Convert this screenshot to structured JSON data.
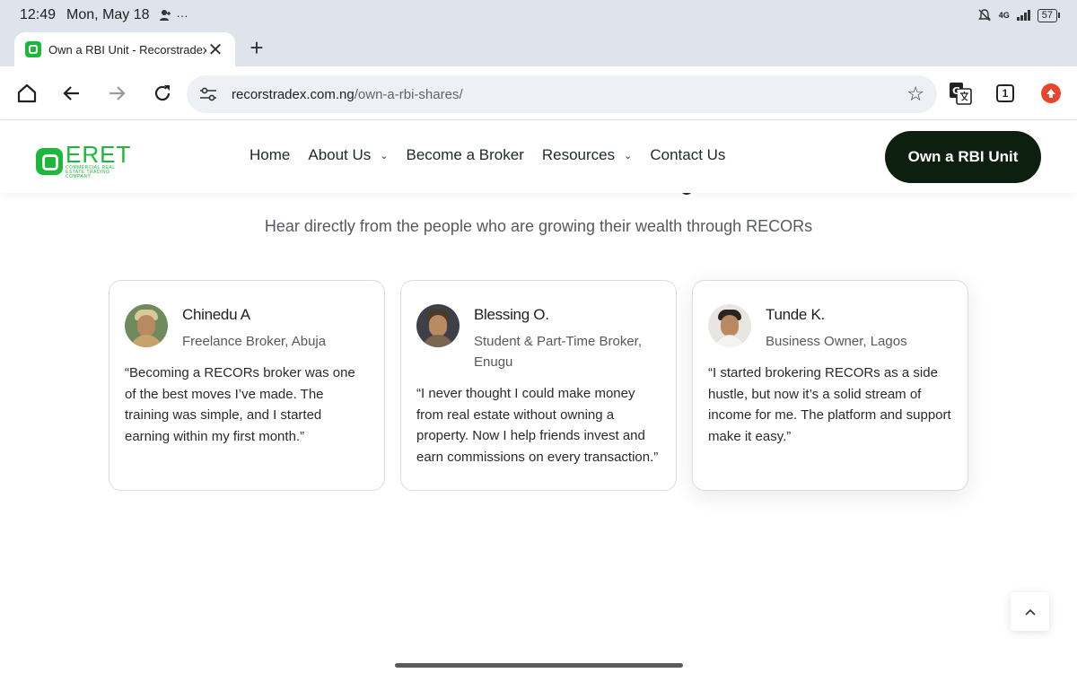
{
  "status_bar": {
    "time": "12:49",
    "date": "Mon, May 18",
    "battery": "57",
    "network": "4G"
  },
  "tab": {
    "title": "Own a RBI Unit - Recorstradex"
  },
  "toolbar": {
    "url_host": "recorstradex.com.ng",
    "url_path": "/own-a-rbi-shares/",
    "tab_count": "1"
  },
  "site": {
    "logo_text": "ERET",
    "logo_tagline": "COMMERCIAL REAL ESTATE TRADING COMPANY",
    "nav": {
      "home": "Home",
      "about": "About Us",
      "broker": "Become a Broker",
      "resources": "Resources",
      "contact": "Contact Us"
    },
    "cta": "Own a RBI Unit"
  },
  "section": {
    "subtitle": "Hear directly from the people who are growing their wealth through RECORs",
    "testimonials": [
      {
        "name": "Chinedu A",
        "role": "Freelance Broker, Abuja",
        "quote": "“Becoming a RECORs broker was one of the best moves I’ve made. The training was simple, and I started earning within my first month.”"
      },
      {
        "name": "Blessing O.",
        "role": "Student & Part-Time Broker, Enugu",
        "quote": "“I never thought I could make money from real estate without owning a property. Now I help friends invest and earn commissions on every transaction.”"
      },
      {
        "name": "Tunde K.",
        "role": "Business Owner, Lagos",
        "quote": "“I started brokering RECORs as a side hustle, but now it’s a solid stream of income for me. The platform and support make it easy.”"
      }
    ]
  },
  "colors": {
    "brand_green": "#1db83a",
    "cta_dark": "#0d1f0f",
    "chrome_bg": "#dfe3eb"
  }
}
